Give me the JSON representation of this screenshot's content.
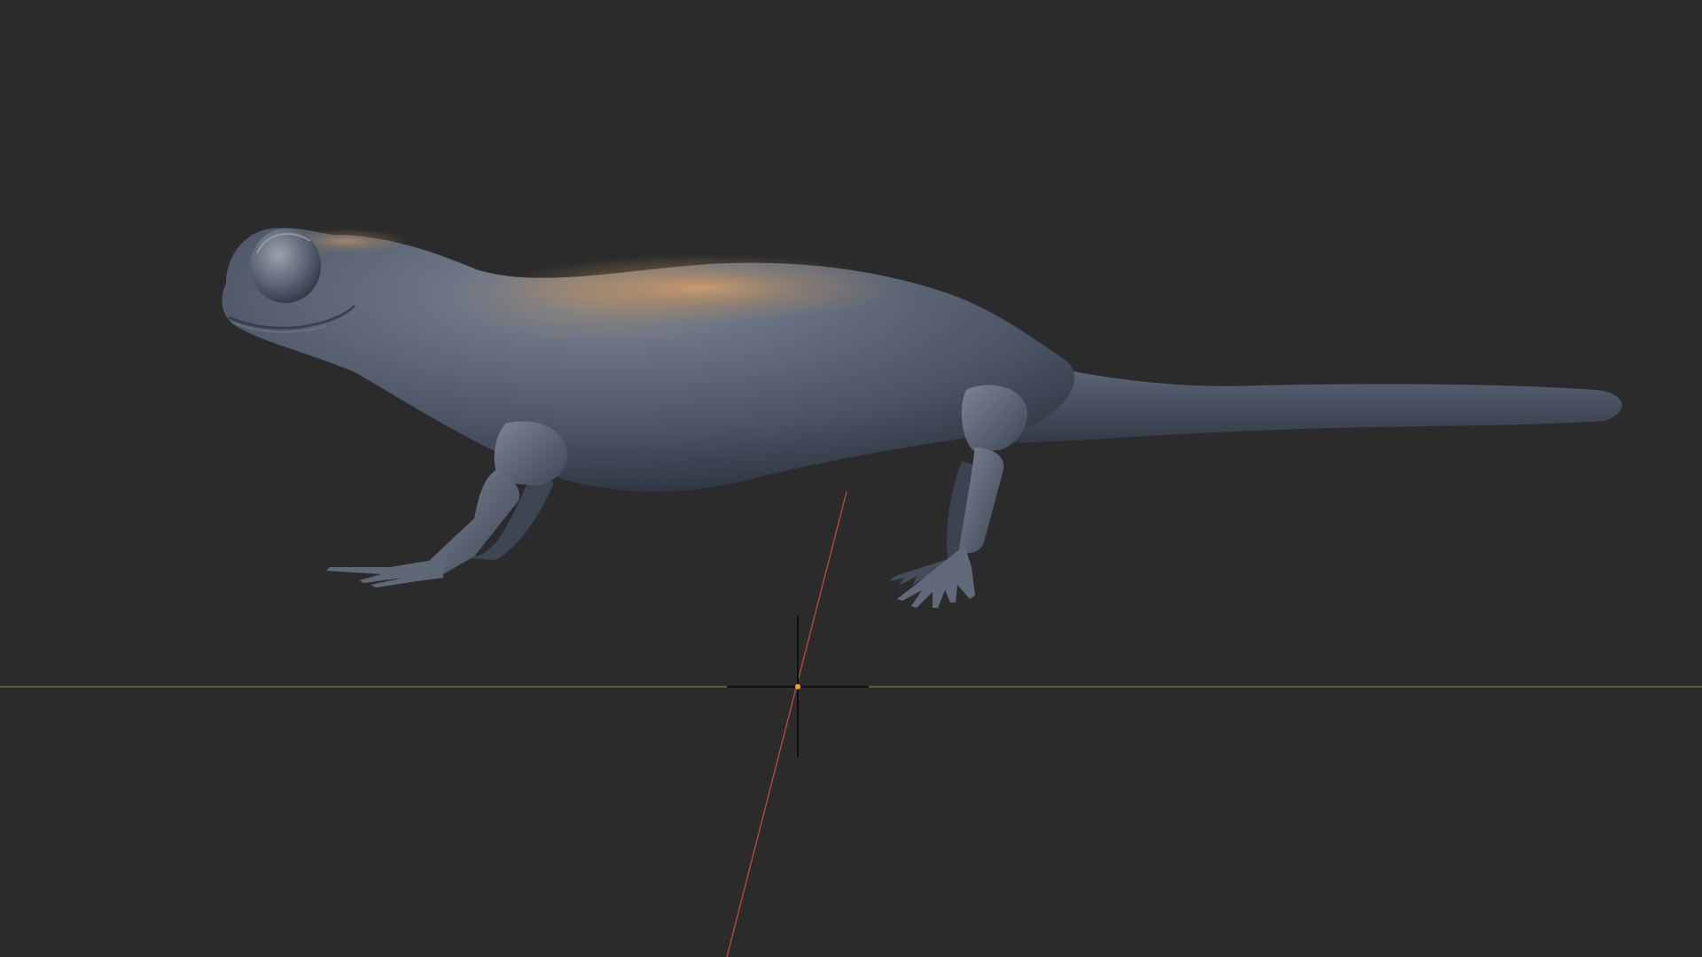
{
  "viewport": {
    "background_color": "#2b2b2b",
    "grid_x_axis_color": "#667a3a",
    "grid_y_axis_color": "#b5493d",
    "cursor_center_color": "#ff9a2a"
  },
  "model": {
    "kind": "salamander sculpt",
    "material_base_color": "#5b6676",
    "material_highlight_color": "#b58a5a"
  }
}
